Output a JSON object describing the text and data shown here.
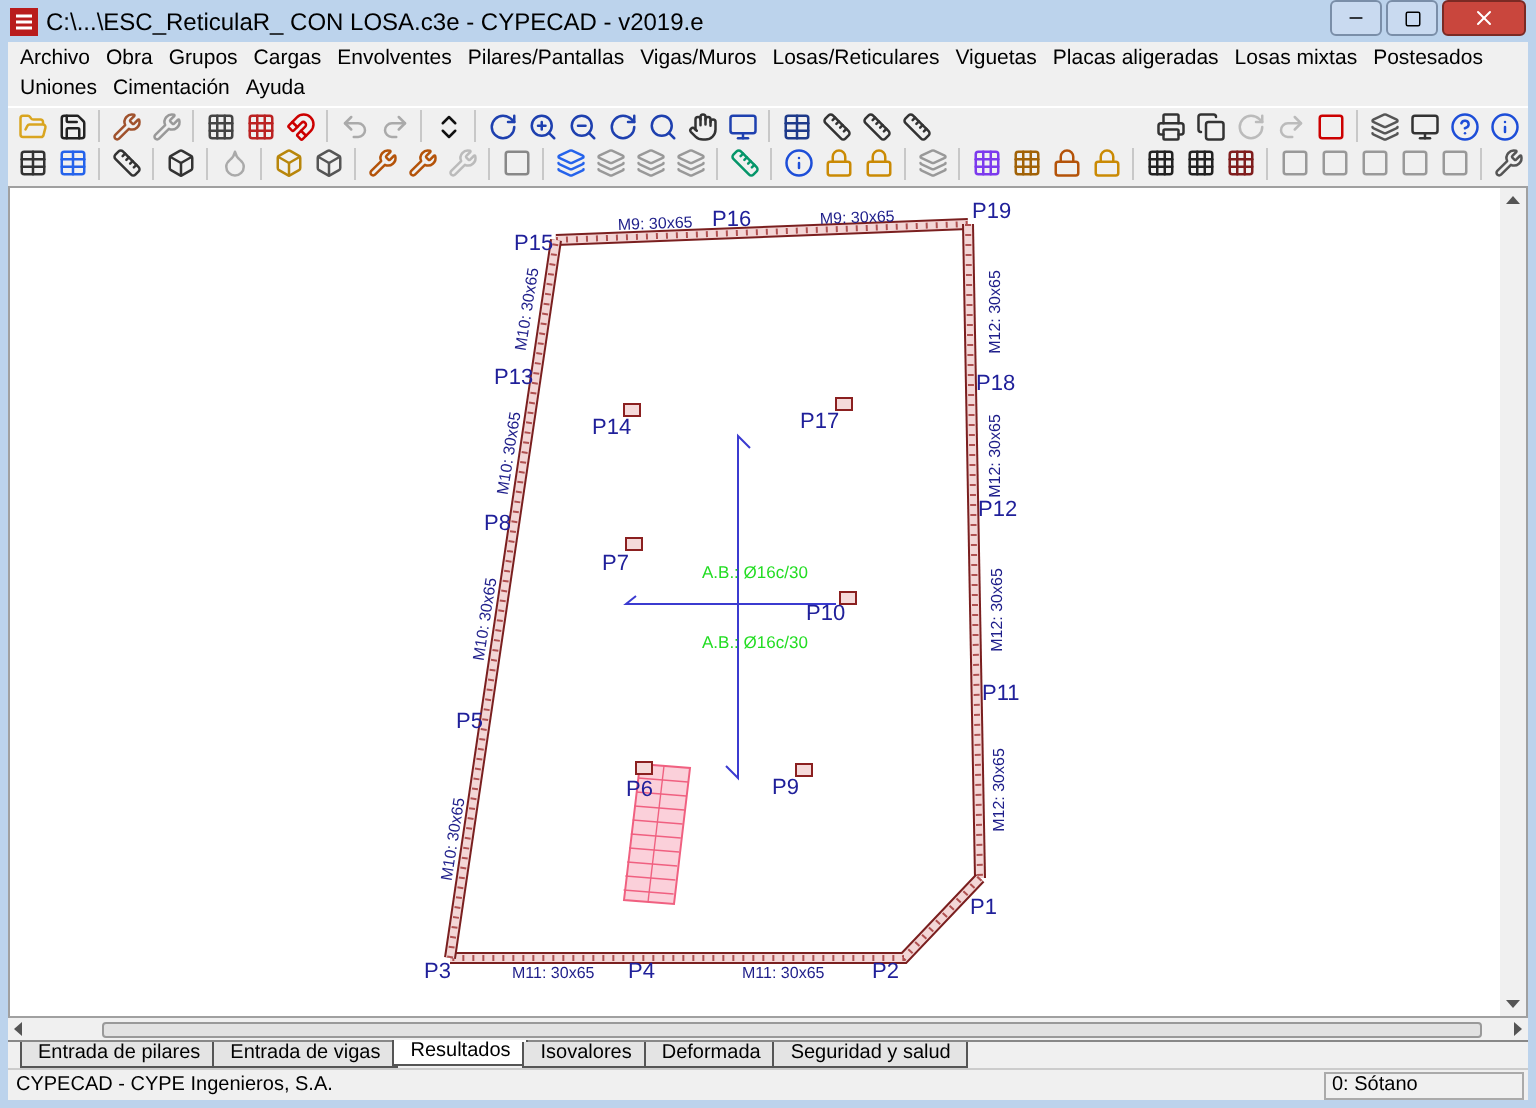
{
  "window": {
    "title": "C:\\...\\ESC_ReticulaR_ CON LOSA.c3e - CYPECAD - v2019.e"
  },
  "menu": [
    "Archivo",
    "Obra",
    "Grupos",
    "Cargas",
    "Envolventes",
    "Pilares/Pantallas",
    "Vigas/Muros",
    "Losas/Reticulares",
    "Viguetas",
    "Placas aligeradas",
    "Losas mixtas",
    "Postesados",
    "Uniones",
    "Cimentación",
    "Ayuda"
  ],
  "canvas": {
    "columns": [
      "P15",
      "P16",
      "P19",
      "P13",
      "P14",
      "P17",
      "P18",
      "P8",
      "P12",
      "P7",
      "P10",
      "P5",
      "P11",
      "P6",
      "P9",
      "P1",
      "P3",
      "P4",
      "P2"
    ],
    "beams": [
      {
        "label": "M9: 30x65",
        "kind": "flat"
      },
      {
        "label": "M9: 30x65",
        "kind": "flat"
      },
      {
        "label": "M10: 30x65",
        "kind": "left"
      },
      {
        "label": "M10: 30x65",
        "kind": "left"
      },
      {
        "label": "M10: 30x65",
        "kind": "left"
      },
      {
        "label": "M10: 30x65",
        "kind": "left"
      },
      {
        "label": "M12: 30x65",
        "kind": "right"
      },
      {
        "label": "M12: 30x65",
        "kind": "right"
      },
      {
        "label": "M12: 30x65",
        "kind": "right"
      },
      {
        "label": "M12: 30x65",
        "kind": "right"
      },
      {
        "label": "M11: 30x65",
        "kind": "flat"
      },
      {
        "label": "M11: 30x65",
        "kind": "flat"
      }
    ],
    "reinforcement": [
      "A.B.: Ø16c/30",
      "A.B.: Ø16c/30"
    ]
  },
  "tabs": [
    {
      "label": "Entrada de pilares",
      "selected": false
    },
    {
      "label": "Entrada de vigas",
      "selected": false
    },
    {
      "label": "Resultados",
      "selected": true
    },
    {
      "label": "Isovalores",
      "selected": false
    },
    {
      "label": "Deformada",
      "selected": false
    },
    {
      "label": "Seguridad y salud",
      "selected": false
    }
  ],
  "status_bar": {
    "left": "CYPECAD - CYPE Ingenieros, S.A.",
    "floor": "0: Sótano"
  }
}
